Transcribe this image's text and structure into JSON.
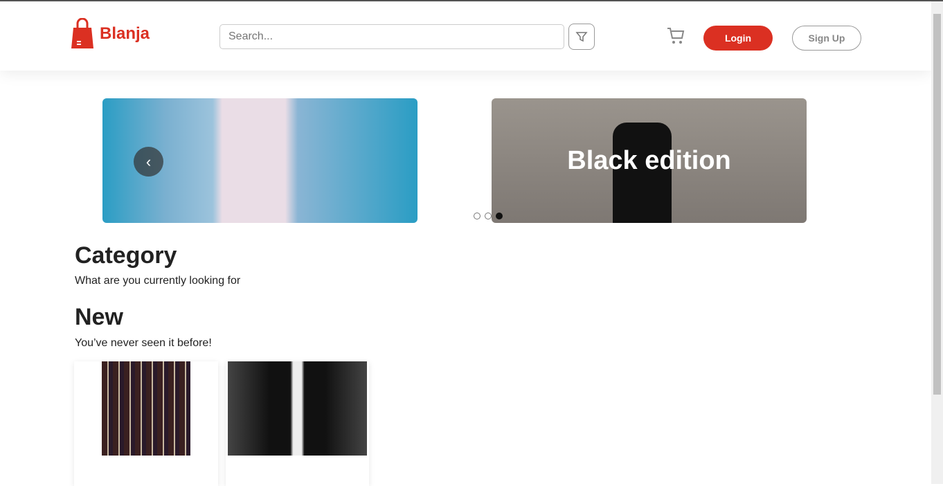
{
  "brand": {
    "name": "Blanja",
    "color": "#db3022",
    "icon": "shopping-bag-icon"
  },
  "header": {
    "search_placeholder": "Search...",
    "filter_icon": "filter-icon",
    "cart_icon": "cart-icon",
    "login": "Login",
    "signup": "Sign Up"
  },
  "carousel": {
    "slides": [
      {
        "caption": ""
      },
      {
        "caption": "Black edition"
      }
    ],
    "active_index": 2,
    "dot_count": 3
  },
  "category": {
    "title": "Category",
    "subtitle": "What are you currently looking for"
  },
  "new": {
    "title": "New",
    "subtitle": "You’ve never seen it before!"
  }
}
